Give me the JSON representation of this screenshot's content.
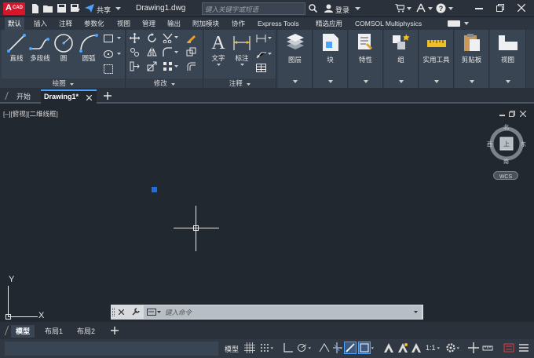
{
  "titlebar": {
    "app_logo": "A",
    "app_logo_sub": "CAD",
    "share_label": "共享",
    "file_name": "Drawing1.dwg",
    "search_placeholder": "键入关键字或短语",
    "login_label": "登录"
  },
  "ribbon_tabs": [
    "默认",
    "插入",
    "注释",
    "参数化",
    "视图",
    "管理",
    "输出",
    "附加模块",
    "协作",
    "Express Tools",
    "精选应用",
    "COMSOL Multiphysics"
  ],
  "active_tab": "默认",
  "draw_panel": {
    "title": "绘图",
    "line": "直线",
    "polyline": "多段线",
    "circle": "圆",
    "arc": "圆弧"
  },
  "modify_panel": {
    "title": "修改"
  },
  "annotation_panel": {
    "title": "注释",
    "text": "文字",
    "dimension": "标注"
  },
  "panels": {
    "layers": "图层",
    "block": "块",
    "properties": "特性",
    "groups": "组",
    "utilities": "实用工具",
    "clipboard": "剪贴板",
    "view": "视图"
  },
  "doc_tabs": {
    "start": "开始",
    "drawing": "Drawing1*"
  },
  "viewport": {
    "label": "[–][俯视][二维线框]",
    "wcs": "WCS",
    "compass": {
      "n": "北",
      "s": "南",
      "e": "东",
      "w": "西",
      "face": "上"
    },
    "ucs_x": "X",
    "ucs_y": "Y"
  },
  "command": {
    "placeholder": "键入命令"
  },
  "layout_tabs": [
    "模型",
    "布局1",
    "布局2"
  ],
  "status": {
    "model": "模型",
    "scale": "1:1"
  },
  "colors": {
    "accent": "#1e6fd9",
    "logo_red": "#d5152a",
    "canvas": "#212830",
    "ribbon": "#3a4553"
  }
}
